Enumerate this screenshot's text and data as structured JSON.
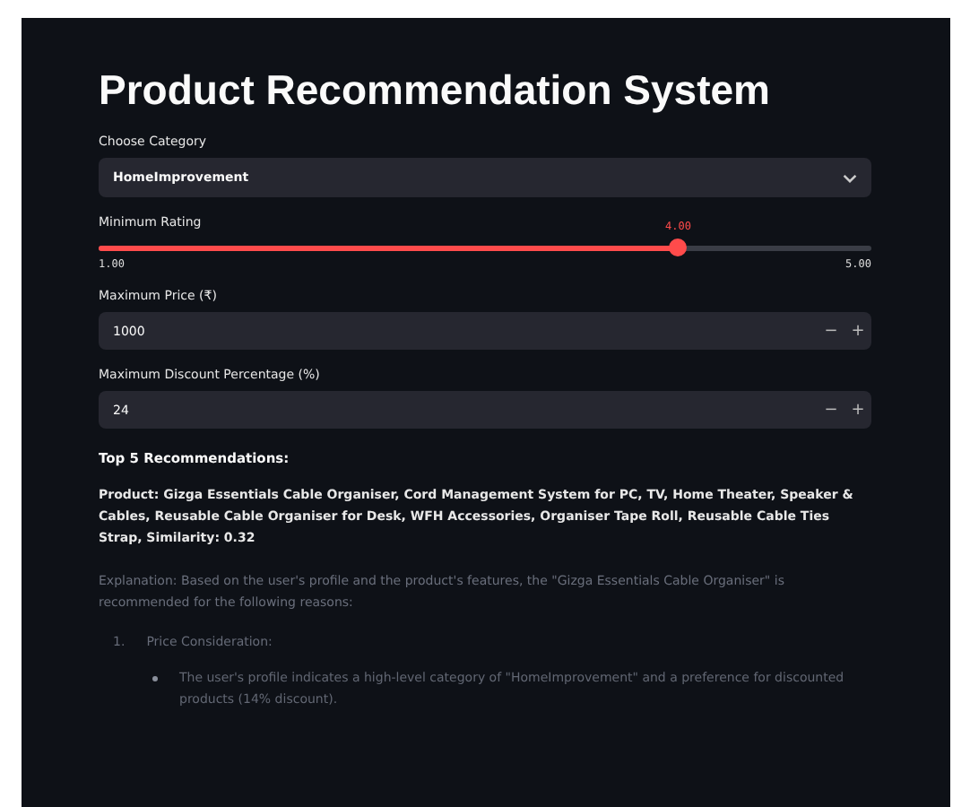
{
  "title": "Product Recommendation System",
  "category": {
    "label": "Choose Category",
    "value": "HomeImprovement"
  },
  "rating": {
    "label": "Minimum Rating",
    "value": "4.00",
    "level": 0.75,
    "min": "1.00",
    "max": "5.00"
  },
  "numbers": [
    {
      "label": "Maximum Price (₹)",
      "value": "1000",
      "minus": "−",
      "plus": "+"
    },
    {
      "label": "Maximum Discount Percentage (%)",
      "value": "24",
      "minus": "−",
      "plus": "+"
    }
  ],
  "results_heading": "Top 5 Recommendations:",
  "product": "Product: Gizga Essentials Cable Organiser, Cord Management System for PC, TV, Home Theater, Speaker & Cables, Reusable Cable Organiser for Desk, WFH Accessories, Organiser Tape Roll, Reusable Cable Ties Strap, Similarity: 0.32",
  "explanation": "Explanation: Based on the user's profile and the product's features, the \"Gizga Essentials Cable Organiser\" is recommended for the following reasons:",
  "reasons": [
    {
      "marker": "1.",
      "title": "Price Consideration:",
      "points": [
        "The user's profile indicates a high-level category of \"HomeImprovement\" and a preference for discounted products (14% discount)."
      ]
    }
  ]
}
